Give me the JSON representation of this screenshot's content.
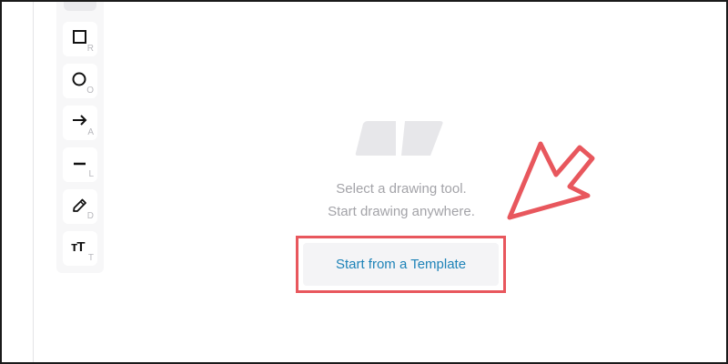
{
  "toolbar": {
    "tools": [
      {
        "name": "rectangle",
        "icon": "square-icon",
        "shortcut": "R"
      },
      {
        "name": "ellipse",
        "icon": "circle-icon",
        "shortcut": "O"
      },
      {
        "name": "arrow",
        "icon": "arrow-right-icon",
        "shortcut": "A"
      },
      {
        "name": "line",
        "icon": "line-icon",
        "shortcut": "L"
      },
      {
        "name": "draw",
        "icon": "pencil-icon",
        "shortcut": "D"
      },
      {
        "name": "text",
        "icon": "text-icon",
        "shortcut": "T",
        "glyph": "ᴛT"
      }
    ]
  },
  "canvas": {
    "hint_line_1": "Select a drawing tool.",
    "hint_line_2": "Start drawing anywhere.",
    "template_button_label": "Start from a Template"
  },
  "colors": {
    "annotation_red": "#e8575d",
    "link_blue": "#1e83b8",
    "hint_gray": "#a3a3a8"
  }
}
